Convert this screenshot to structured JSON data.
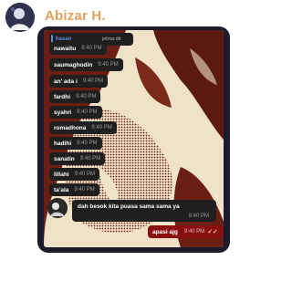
{
  "contact": {
    "name": "Abizar H."
  },
  "reply": {
    "author": "hasan",
    "snippet": "jelma dit"
  },
  "messages": [
    {
      "text": "nawaitu",
      "time": "9:40 PM"
    },
    {
      "text": "saumaghodin",
      "time": "9:40 PM"
    },
    {
      "text": "an' ada i",
      "time": "9:40 PM"
    },
    {
      "text": "fardhi",
      "time": "9:40 PM"
    },
    {
      "text": "syahri",
      "time": "9:40 PM"
    },
    {
      "text": "romadhona",
      "time": "9:40 PM"
    },
    {
      "text": "hadihi",
      "time": "9:40 PM"
    },
    {
      "text": "sanatin",
      "time": "9:40 PM"
    },
    {
      "text": "lillahi",
      "time": "9:40 PM"
    },
    {
      "text": "ta'ala",
      "time": "9:40 PM"
    }
  ],
  "long_message": {
    "text": "dah besok kita puasa sama sama ya",
    "time": "9:40 PM"
  },
  "outgoing": {
    "text": "apasi ajg",
    "time": "9:40 PM",
    "status_icon": "double-check-icon"
  },
  "colors": {
    "name": "#e0a15a",
    "outgoing_bubble": "#8a1010",
    "card": "#1c1b2b",
    "wallpaper_dark": "#6b1f14",
    "wallpaper_light": "#f0e2c8"
  }
}
